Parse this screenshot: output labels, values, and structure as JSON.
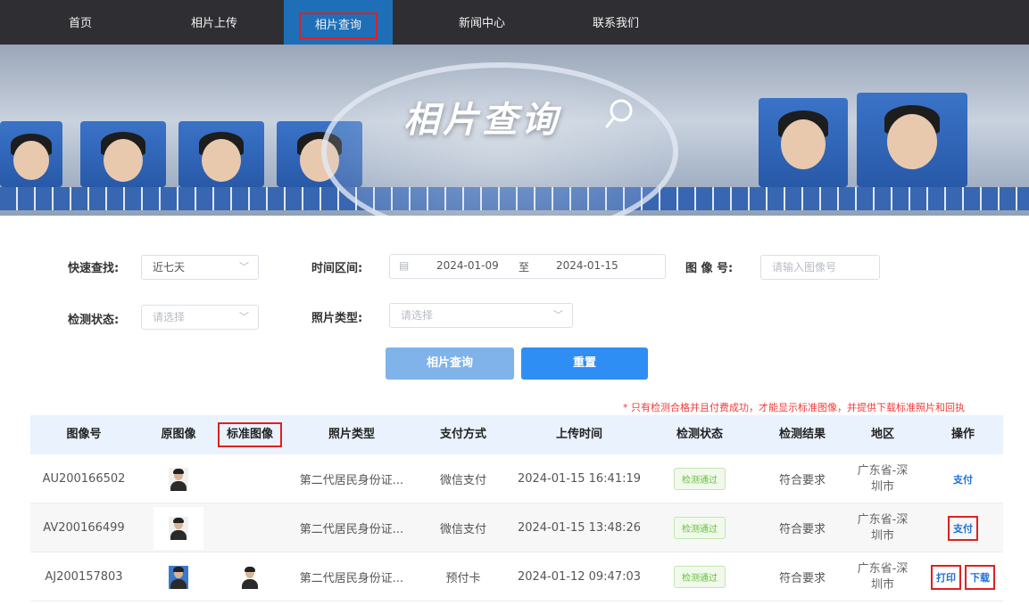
{
  "nav": {
    "items": [
      {
        "label": "首页"
      },
      {
        "label": "相片上传"
      },
      {
        "label": "相片查询"
      },
      {
        "label": "新闻中心"
      },
      {
        "label": "联系我们"
      }
    ]
  },
  "banner": {
    "title": "相片查询"
  },
  "filters": {
    "quick_label": "快速查找:",
    "quick_value": "近七天",
    "time_label": "时间区间:",
    "date_start": "2024-01-09",
    "date_sep": "至",
    "date_end": "2024-01-15",
    "image_no_label": "图 像 号:",
    "image_no_placeholder": "请输入图像号",
    "status_label": "检测状态:",
    "status_placeholder": "请选择",
    "type_label": "照片类型:",
    "type_placeholder": "请选择",
    "search_button": "相片查询",
    "reset_button": "重置"
  },
  "notice": "* 只有检测合格并且付费成功，才能显示标准图像，并提供下载标准照片和回执",
  "table": {
    "headers": [
      "图像号",
      "原图像",
      "标准图像",
      "照片类型",
      "支付方式",
      "上传时间",
      "检测状态",
      "检测结果",
      "地区",
      "操作"
    ],
    "rows": [
      {
        "id": "AU200166502",
        "type": "第二代居民身份证...",
        "payment": "微信支付",
        "time": "2024-01-15 16:41:19",
        "status": "检测通过",
        "result": "符合要求",
        "region_1": "广东省-深",
        "region_2": "圳市",
        "actions": [
          "支付"
        ]
      },
      {
        "id": "AV200166499",
        "type": "第二代居民身份证...",
        "payment": "微信支付",
        "time": "2024-01-15 13:48:26",
        "status": "检测通过",
        "result": "符合要求",
        "region_1": "广东省-深",
        "region_2": "圳市",
        "actions": [
          "支付"
        ]
      },
      {
        "id": "AJ200157803",
        "type": "第二代居民身份证...",
        "payment": "预付卡",
        "time": "2024-01-12 09:47:03",
        "status": "检测通过",
        "result": "符合要求",
        "region_1": "广东省-深",
        "region_2": "圳市",
        "actions": [
          "打印",
          "下载"
        ]
      }
    ]
  },
  "colors": {
    "nav_bg": "#2f2f33",
    "nav_active": "#1e6fb8",
    "highlight_box": "#e02020",
    "primary_button": "#2f8ef3",
    "search_button": "#7fb3ea",
    "status_green": "#67c23a",
    "table_header_bg": "#e9f2fd"
  },
  "icons": {
    "banner_search": "magnifier-icon",
    "dropdown": "chevron-down-icon",
    "date": "calendar-icon"
  }
}
